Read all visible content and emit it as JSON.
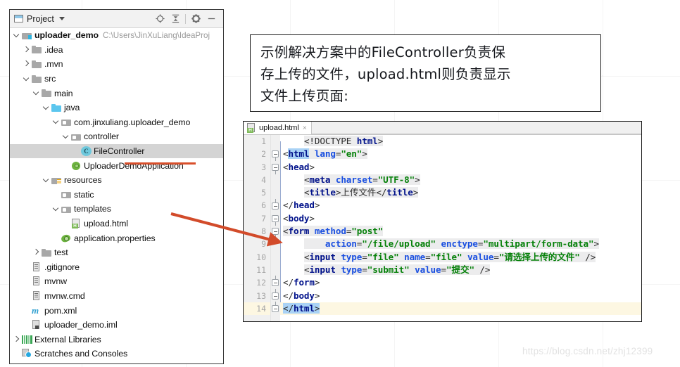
{
  "project_panel": {
    "title": "Project",
    "toolbar_icons": [
      "locate-icon",
      "collapse-all-icon",
      "settings-gear-icon",
      "minimize-icon"
    ],
    "tree": [
      {
        "indent": 0,
        "arrow": "down",
        "icon": "folder-module-icon",
        "label": "uploader_demo",
        "bold": true,
        "path": "C:\\Users\\JinXuLiang\\IdeaProj",
        "selected": false
      },
      {
        "indent": 1,
        "arrow": "right",
        "icon": "folder-icon",
        "label": ".idea",
        "bold": false,
        "path": "",
        "selected": false
      },
      {
        "indent": 1,
        "arrow": "right",
        "icon": "folder-icon",
        "label": ".mvn",
        "bold": false,
        "path": "",
        "selected": false
      },
      {
        "indent": 1,
        "arrow": "down",
        "icon": "folder-icon",
        "label": "src",
        "bold": false,
        "path": "",
        "selected": false
      },
      {
        "indent": 2,
        "arrow": "down",
        "icon": "folder-icon",
        "label": "main",
        "bold": false,
        "path": "",
        "selected": false
      },
      {
        "indent": 3,
        "arrow": "down",
        "icon": "folder-source-icon",
        "label": "java",
        "bold": false,
        "path": "",
        "selected": false
      },
      {
        "indent": 4,
        "arrow": "down",
        "icon": "package-icon",
        "label": "com.jinxuliang.uploader_demo",
        "bold": false,
        "path": "",
        "selected": false
      },
      {
        "indent": 5,
        "arrow": "down",
        "icon": "package-icon",
        "label": "controller",
        "bold": false,
        "path": "",
        "selected": false
      },
      {
        "indent": 6,
        "arrow": "none",
        "icon": "java-class-icon",
        "label": "FileController",
        "bold": false,
        "path": "",
        "selected": true
      },
      {
        "indent": 5,
        "arrow": "none",
        "icon": "spring-boot-icon",
        "label": "UploaderDemoApplication",
        "bold": false,
        "path": "",
        "selected": false
      },
      {
        "indent": 3,
        "arrow": "down",
        "icon": "folder-resources-icon",
        "label": "resources",
        "bold": false,
        "path": "",
        "selected": false
      },
      {
        "indent": 4,
        "arrow": "none",
        "icon": "package-icon",
        "label": "static",
        "bold": false,
        "path": "",
        "selected": false
      },
      {
        "indent": 4,
        "arrow": "down",
        "icon": "package-icon",
        "label": "templates",
        "bold": false,
        "path": "",
        "selected": false
      },
      {
        "indent": 5,
        "arrow": "none",
        "icon": "html-file-icon",
        "label": "upload.html",
        "bold": false,
        "path": "",
        "selected": false
      },
      {
        "indent": 4,
        "arrow": "none",
        "icon": "properties-file-icon",
        "label": "application.properties",
        "bold": false,
        "path": "",
        "selected": false
      },
      {
        "indent": 2,
        "arrow": "right",
        "icon": "folder-icon",
        "label": "test",
        "bold": false,
        "path": "",
        "selected": false
      },
      {
        "indent": 1,
        "arrow": "none",
        "icon": "text-file-icon",
        "label": ".gitignore",
        "bold": false,
        "path": "",
        "selected": false
      },
      {
        "indent": 1,
        "arrow": "none",
        "icon": "text-file-icon",
        "label": "mvnw",
        "bold": false,
        "path": "",
        "selected": false
      },
      {
        "indent": 1,
        "arrow": "none",
        "icon": "text-file-icon",
        "label": "mvnw.cmd",
        "bold": false,
        "path": "",
        "selected": false
      },
      {
        "indent": 1,
        "arrow": "none",
        "icon": "maven-icon",
        "label": "pom.xml",
        "bold": false,
        "path": "",
        "selected": false
      },
      {
        "indent": 1,
        "arrow": "none",
        "icon": "iml-file-icon",
        "label": "uploader_demo.iml",
        "bold": false,
        "path": "",
        "selected": false
      },
      {
        "indent": 0,
        "arrow": "right",
        "icon": "external-libraries-icon",
        "label": "External Libraries",
        "bold": false,
        "path": "",
        "selected": false
      },
      {
        "indent": 0,
        "arrow": "none",
        "icon": "scratches-icon",
        "label": "Scratches and Consoles",
        "bold": false,
        "path": "",
        "selected": false
      }
    ]
  },
  "note": {
    "text": "示例解决方案中的FileController负责保\n存上传的文件，upload.html则负责显示\n文件上传页面:"
  },
  "editor": {
    "tab": {
      "label": "upload.html",
      "close": "×",
      "icon": "html-file-icon"
    },
    "current_line": 14,
    "lines": [
      {
        "n": 1,
        "fold": "none",
        "tokens": [
          {
            "t": "    ",
            "c": "plain",
            "bg": ""
          },
          {
            "t": "<!DOCTYPE ",
            "c": "dcty",
            "bg": "hl"
          },
          {
            "t": "html",
            "c": "tag",
            "bg": "hl"
          },
          {
            "t": ">",
            "c": "punct",
            "bg": "hl"
          }
        ]
      },
      {
        "n": 2,
        "fold": "down",
        "tokens": [
          {
            "t": "<",
            "c": "punct",
            "bg": ""
          },
          {
            "t": "html",
            "c": "tag",
            "bg": "sel"
          },
          {
            "t": " ",
            "c": "plain",
            "bg": "hl"
          },
          {
            "t": "lang",
            "c": "attr",
            "bg": "hl"
          },
          {
            "t": "=",
            "c": "punct",
            "bg": "hl"
          },
          {
            "t": "\"en\"",
            "c": "val",
            "bg": "hl"
          },
          {
            "t": ">",
            "c": "punct",
            "bg": "hl"
          }
        ]
      },
      {
        "n": 3,
        "fold": "down",
        "tokens": [
          {
            "t": "<",
            "c": "punct",
            "bg": ""
          },
          {
            "t": "head",
            "c": "tag",
            "bg": ""
          },
          {
            "t": ">",
            "c": "punct",
            "bg": ""
          }
        ]
      },
      {
        "n": 4,
        "fold": "none",
        "tokens": [
          {
            "t": "    ",
            "c": "plain",
            "bg": ""
          },
          {
            "t": "<",
            "c": "punct",
            "bg": "hl"
          },
          {
            "t": "meta ",
            "c": "tag",
            "bg": "hl"
          },
          {
            "t": "charset",
            "c": "attr",
            "bg": "hl"
          },
          {
            "t": "=",
            "c": "punct",
            "bg": "hl"
          },
          {
            "t": "\"UTF-8\"",
            "c": "val",
            "bg": "hl"
          },
          {
            "t": ">",
            "c": "punct",
            "bg": "hl"
          }
        ]
      },
      {
        "n": 5,
        "fold": "none",
        "tokens": [
          {
            "t": "    ",
            "c": "plain",
            "bg": ""
          },
          {
            "t": "<",
            "c": "punct",
            "bg": "hl"
          },
          {
            "t": "title",
            "c": "tag",
            "bg": "hl"
          },
          {
            "t": ">",
            "c": "punct",
            "bg": "hl"
          },
          {
            "t": "上传文件",
            "c": "plain",
            "bg": "hl"
          },
          {
            "t": "</",
            "c": "punct",
            "bg": "hl"
          },
          {
            "t": "title",
            "c": "tag",
            "bg": "hl"
          },
          {
            "t": ">",
            "c": "punct",
            "bg": "hl"
          }
        ]
      },
      {
        "n": 6,
        "fold": "up",
        "tokens": [
          {
            "t": "</",
            "c": "punct",
            "bg": ""
          },
          {
            "t": "head",
            "c": "tag",
            "bg": ""
          },
          {
            "t": ">",
            "c": "punct",
            "bg": ""
          }
        ]
      },
      {
        "n": 7,
        "fold": "down",
        "tokens": [
          {
            "t": "<",
            "c": "punct",
            "bg": ""
          },
          {
            "t": "body",
            "c": "tag",
            "bg": ""
          },
          {
            "t": ">",
            "c": "punct",
            "bg": ""
          }
        ]
      },
      {
        "n": 8,
        "fold": "down",
        "tokens": [
          {
            "t": "<",
            "c": "punct",
            "bg": "hl"
          },
          {
            "t": "form ",
            "c": "tag",
            "bg": "hl"
          },
          {
            "t": "method",
            "c": "attr",
            "bg": "hl"
          },
          {
            "t": "=",
            "c": "punct",
            "bg": "hl"
          },
          {
            "t": "\"post\"",
            "c": "val",
            "bg": "hl"
          }
        ]
      },
      {
        "n": 9,
        "fold": "none",
        "tokens": [
          {
            "t": "    ",
            "c": "plain",
            "bg": ""
          },
          {
            "t": "    ",
            "c": "plain",
            "bg": "hl"
          },
          {
            "t": "action",
            "c": "attr",
            "bg": "hl"
          },
          {
            "t": "=",
            "c": "punct",
            "bg": "hl"
          },
          {
            "t": "\"/file/upload\"",
            "c": "val",
            "bg": "hl"
          },
          {
            "t": " ",
            "c": "plain",
            "bg": "hl"
          },
          {
            "t": "enctype",
            "c": "attr",
            "bg": "hl"
          },
          {
            "t": "=",
            "c": "punct",
            "bg": "hl"
          },
          {
            "t": "\"multipart/form-data\"",
            "c": "val",
            "bg": "hl"
          },
          {
            "t": ">",
            "c": "punct",
            "bg": "hl"
          }
        ]
      },
      {
        "n": 10,
        "fold": "none",
        "tokens": [
          {
            "t": "    ",
            "c": "plain",
            "bg": ""
          },
          {
            "t": "<",
            "c": "punct",
            "bg": "hl"
          },
          {
            "t": "input ",
            "c": "tag",
            "bg": "hl"
          },
          {
            "t": "type",
            "c": "attr",
            "bg": "hl"
          },
          {
            "t": "=",
            "c": "punct",
            "bg": "hl"
          },
          {
            "t": "\"file\"",
            "c": "val",
            "bg": "hl"
          },
          {
            "t": " ",
            "c": "plain",
            "bg": "hl"
          },
          {
            "t": "name",
            "c": "attr",
            "bg": "hl"
          },
          {
            "t": "=",
            "c": "punct",
            "bg": "hl"
          },
          {
            "t": "\"file\"",
            "c": "val",
            "bg": "hl"
          },
          {
            "t": " ",
            "c": "plain",
            "bg": "hl"
          },
          {
            "t": "value",
            "c": "attr",
            "bg": "hl"
          },
          {
            "t": "=",
            "c": "punct",
            "bg": "hl"
          },
          {
            "t": "\"请选择上传的文件\"",
            "c": "val",
            "bg": "hl"
          },
          {
            "t": " />",
            "c": "punct",
            "bg": "hl"
          }
        ]
      },
      {
        "n": 11,
        "fold": "none",
        "tokens": [
          {
            "t": "    ",
            "c": "plain",
            "bg": ""
          },
          {
            "t": "<",
            "c": "punct",
            "bg": "hl"
          },
          {
            "t": "input ",
            "c": "tag",
            "bg": "hl"
          },
          {
            "t": "type",
            "c": "attr",
            "bg": "hl"
          },
          {
            "t": "=",
            "c": "punct",
            "bg": "hl"
          },
          {
            "t": "\"submit\"",
            "c": "val",
            "bg": "hl"
          },
          {
            "t": " ",
            "c": "plain",
            "bg": "hl"
          },
          {
            "t": "value",
            "c": "attr",
            "bg": "hl"
          },
          {
            "t": "=",
            "c": "punct",
            "bg": "hl"
          },
          {
            "t": "\"提交\"",
            "c": "val",
            "bg": "hl"
          },
          {
            "t": " />",
            "c": "punct",
            "bg": "hl"
          }
        ]
      },
      {
        "n": 12,
        "fold": "up",
        "tokens": [
          {
            "t": "</",
            "c": "punct",
            "bg": ""
          },
          {
            "t": "form",
            "c": "tag",
            "bg": ""
          },
          {
            "t": ">",
            "c": "punct",
            "bg": ""
          }
        ]
      },
      {
        "n": 13,
        "fold": "up",
        "tokens": [
          {
            "t": "</",
            "c": "punct",
            "bg": ""
          },
          {
            "t": "body",
            "c": "tag",
            "bg": ""
          },
          {
            "t": ">",
            "c": "punct",
            "bg": ""
          }
        ]
      },
      {
        "n": 14,
        "fold": "up",
        "tokens": [
          {
            "t": "</",
            "c": "punct",
            "bg": "sel"
          },
          {
            "t": "html",
            "c": "tag",
            "bg": "sel"
          },
          {
            "t": ">",
            "c": "punct",
            "bg": "sel"
          }
        ]
      }
    ]
  },
  "annotations": {
    "color": "#d24b2a",
    "underline_target": "FileController",
    "arrow_from": "upload.html",
    "arrow_to": "line-8-form-tag"
  },
  "watermark": {
    "text": "https://blog.csdn.net/zhj12399"
  }
}
